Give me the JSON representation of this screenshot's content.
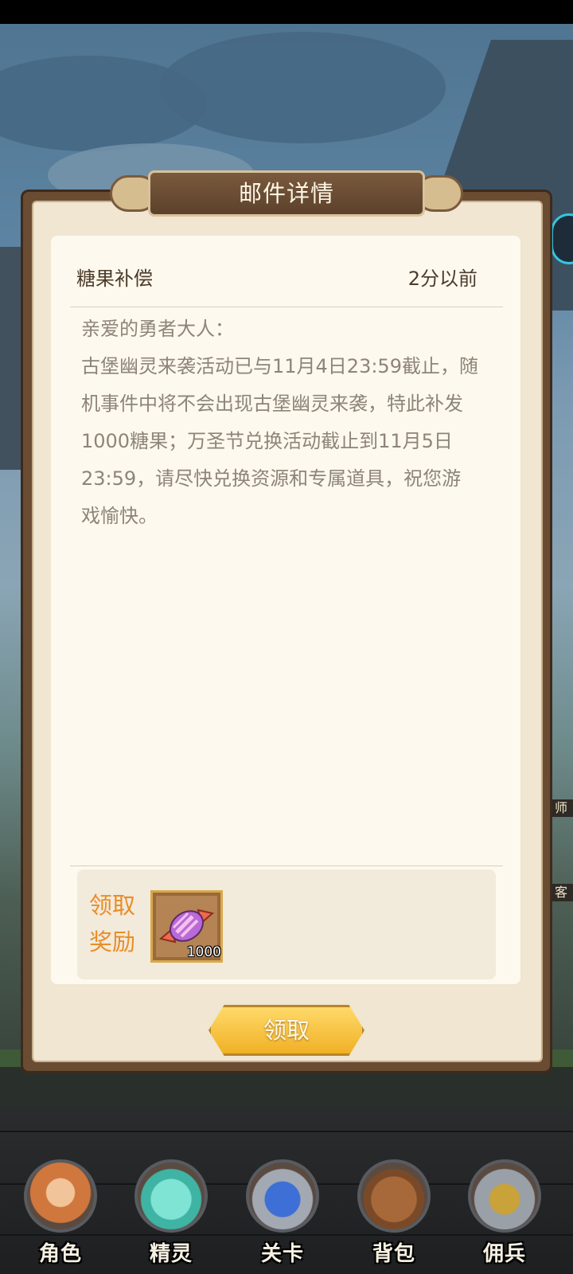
{
  "modal": {
    "title": "邮件详情",
    "subject": "糖果补偿",
    "time": "2分以前",
    "body": "亲爱的勇者大人：\n古堡幽灵来袭活动已与11月4日23:59截止，随机事件中将不会出现古堡幽灵来袭，特此补发1000糖果；万圣节兑换活动截止到11月5日23:59，请尽快兑换资源和专属道具，祝您游戏愉快。",
    "reward_label": "领取奖励",
    "reward_item": {
      "icon": "candy-icon",
      "count": "1000"
    },
    "claim_button": "领取"
  },
  "side_tags": [
    "师",
    "客"
  ],
  "bottom_nav": [
    {
      "label": "角色",
      "icon": "character-portrait-icon"
    },
    {
      "label": "精灵",
      "icon": "spirit-portrait-icon"
    },
    {
      "label": "关卡",
      "icon": "stage-swords-icon"
    },
    {
      "label": "背包",
      "icon": "backpack-icon"
    },
    {
      "label": "佣兵",
      "icon": "mercenary-helmet-icon"
    }
  ],
  "colors": {
    "accent_orange": "#e98d27",
    "button_gold": "#f0b125",
    "frame_brown": "#6a4c33",
    "notification_dot": "#ef2a2a"
  }
}
